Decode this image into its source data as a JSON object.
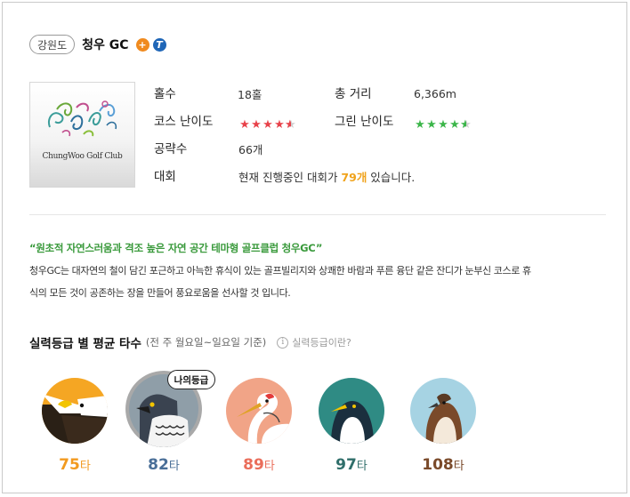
{
  "header": {
    "region": "강원도",
    "club_name": "청우 GC",
    "badge_orange": "+",
    "badge_blue": "T"
  },
  "logo": {
    "text": "ChungWoo Golf Club"
  },
  "info": {
    "holes_label": "홀수",
    "holes_value": "18홀",
    "distance_label": "총 거리",
    "distance_value": "6,366m",
    "course_difficulty_label": "코스 난이도",
    "course_difficulty_stars": 4.5,
    "green_difficulty_label": "그린 난이도",
    "green_difficulty_stars": 4.5,
    "guides_label": "공략수",
    "guides_value": "66개",
    "tournament_label": "대회",
    "tournament_prefix": "현재 진행중인 대회가 ",
    "tournament_count": "79개",
    "tournament_suffix": " 있습니다."
  },
  "intro": {
    "title": "“원초적 자연스러움과 격조 높은 자연 공간 테마형 골프클럽 청우GC”",
    "line1": "청우GC는 대자연의 철이 담긴 포근하고 아늑한 휴식이 있는 골프빌리지와 상쾌한 바람과 푸른 융단 같은 잔디가 눈부신 코스로 휴",
    "line2": "식의 모든 것이 공존하는 장을 만들어 풍요로움을 선사할 것 입니다."
  },
  "grades_section": {
    "title": "실력등급 별 평균 타수",
    "subtitle": "(전 주 월요일~일요일 기준)",
    "help_icon": "i",
    "help_text": "실력등급이란?",
    "my_grade_label": "나의등급",
    "unit": "타",
    "grades": [
      {
        "name": "eagle",
        "score": "75",
        "color": "#f29a1f"
      },
      {
        "name": "hawk",
        "score": "82",
        "color": "#4a6f98"
      },
      {
        "name": "crane",
        "score": "89",
        "color": "#ea6d5a"
      },
      {
        "name": "penguin",
        "score": "97",
        "color": "#2f6e6a"
      },
      {
        "name": "sparrow",
        "score": "108",
        "color": "#7a4a2a"
      }
    ]
  },
  "colors": {
    "accent_green": "#3a9a3c",
    "accent_orange": "#f0a31c",
    "star_red": "#e8424a",
    "star_green": "#3cb64a"
  }
}
